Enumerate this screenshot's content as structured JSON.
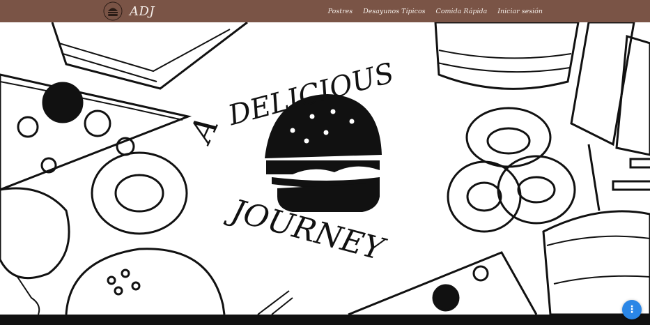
{
  "navbar": {
    "brand": "ADJ",
    "links": [
      "Postres",
      "Desayunos Típicos",
      "Comida Rápida",
      "Iniciar sesión"
    ]
  },
  "hero": {
    "logo_text": [
      "A",
      "DELICIOUS",
      "JOURNEY"
    ]
  },
  "fab": {
    "icon": "more-vert-icon",
    "glyph": "⋮",
    "color": "#2a86e6"
  },
  "colors": {
    "navbar": "#7a5446",
    "nav_text": "#f3ece7",
    "bottom_bar": "#111111"
  }
}
